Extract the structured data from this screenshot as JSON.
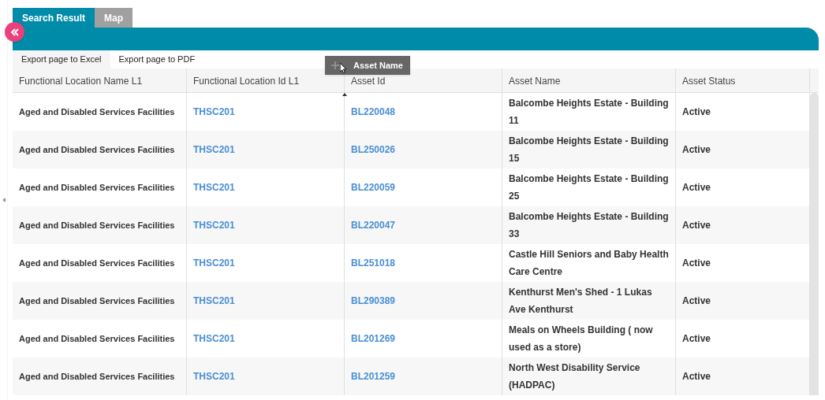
{
  "tabs": [
    {
      "label": "Search Result",
      "selected": true
    },
    {
      "label": "Map",
      "selected": false
    }
  ],
  "toolbar": [
    "Export page to Excel",
    "Export page to PDF"
  ],
  "drag_column": {
    "label": "Asset Name"
  },
  "table": {
    "columns": [
      "Functional Location Name L1",
      "Functional Location Id L1",
      "Asset Id",
      "Asset Name",
      "Asset Status"
    ],
    "rows": [
      [
        "Aged and Disabled Services Facilities",
        "THSC201",
        "BL220048",
        "Balcombe Heights Estate - Building 11",
        "Active"
      ],
      [
        "Aged and Disabled Services Facilities",
        "THSC201",
        "BL250026",
        "Balcombe Heights Estate - Building 15",
        "Active"
      ],
      [
        "Aged and Disabled Services Facilities",
        "THSC201",
        "BL220059",
        "Balcombe Heights Estate - Building 25",
        "Active"
      ],
      [
        "Aged and Disabled Services Facilities",
        "THSC201",
        "BL220047",
        "Balcombe Heights Estate - Building 33",
        "Active"
      ],
      [
        "Aged and Disabled Services Facilities",
        "THSC201",
        "BL251018",
        "Castle Hill Seniors and Baby Health Care Centre",
        "Active"
      ],
      [
        "Aged and Disabled Services Facilities",
        "THSC201",
        "BL290389",
        "Kenthurst Men's Shed - 1 Lukas Ave Kenthurst",
        "Active"
      ],
      [
        "Aged and Disabled Services Facilities",
        "THSC201",
        "BL201269",
        "Meals on Wheels Building ( now used as a store)",
        "Active"
      ],
      [
        "Aged and Disabled Services Facilities",
        "THSC201",
        "BL201259",
        "North West Disability Service (HADPAC)",
        "Active"
      ]
    ]
  }
}
